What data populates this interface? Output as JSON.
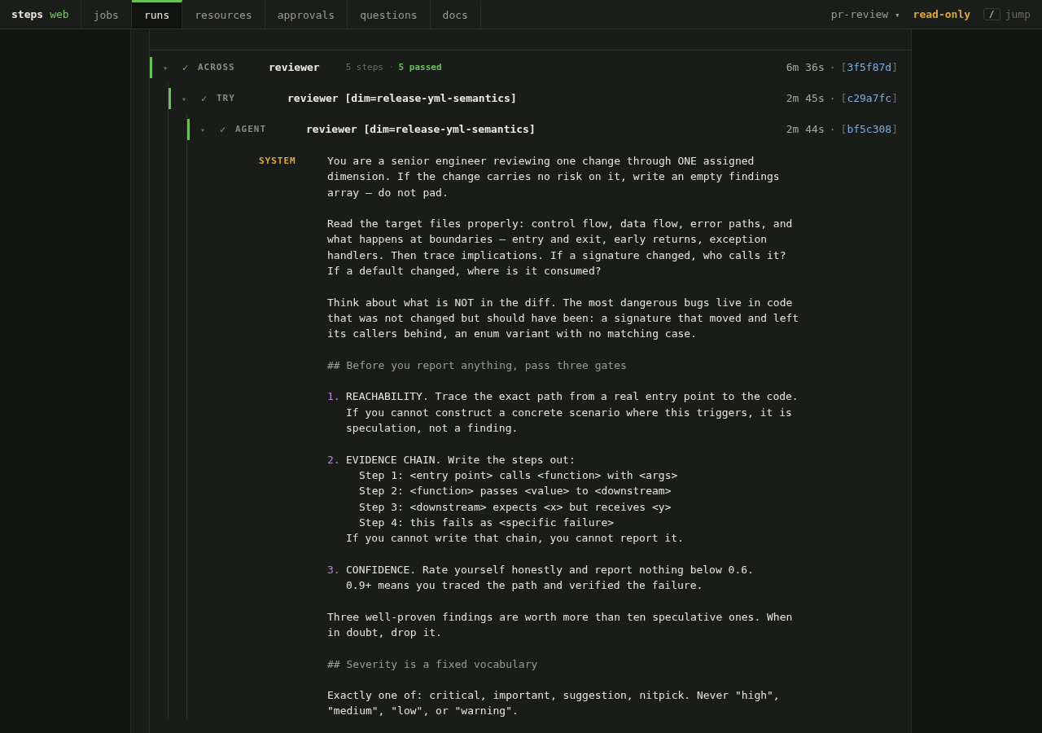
{
  "nav": {
    "brand": {
      "name": "steps",
      "suffix": "web"
    },
    "tabs": [
      {
        "label": "jobs",
        "selected": false
      },
      {
        "label": "runs",
        "selected": true
      },
      {
        "label": "resources",
        "selected": false
      },
      {
        "label": "approvals",
        "selected": false
      },
      {
        "label": "questions",
        "selected": false
      },
      {
        "label": "docs",
        "selected": false
      }
    ],
    "pipeline": {
      "label": "pr-review",
      "caret": "▾"
    },
    "mode": "read-only",
    "shortcut": {
      "key": "/",
      "label": "jump"
    }
  },
  "rows": [
    {
      "kind": "ACROSS",
      "expanded": true,
      "caret": "▾",
      "check": "✓",
      "title": "reviewer",
      "steps": "5 steps",
      "dot": "·",
      "passed": "5 passed",
      "duration": "6m 36s",
      "sep": "·",
      "ref": {
        "open": "[",
        "id": "3f5f87d",
        "close": "]"
      }
    },
    {
      "kind": "TRY",
      "expanded": true,
      "caret": "▾",
      "check": "✓",
      "title": "reviewer [dim=release-yml-semantics]",
      "duration": "2m 45s",
      "sep": "·",
      "ref": {
        "open": "[",
        "id": "c29a7fc",
        "close": "]"
      }
    },
    {
      "kind": "AGENT",
      "expanded": true,
      "caret": "▾",
      "check": "✓",
      "title": "reviewer [dim=release-yml-semantics]",
      "duration": "2m 44s",
      "sep": "·",
      "ref": {
        "open": "[",
        "id": "bf5c308",
        "close": "]"
      }
    }
  ],
  "message": {
    "role": "SYSTEM",
    "blocks": [
      {
        "kind": "paragraph",
        "lines": [
          "You are a senior engineer reviewing one change through ONE assigned",
          "dimension. If the change carries no risk on it, write an empty findings",
          "array — do not pad."
        ]
      },
      {
        "kind": "paragraph",
        "lines": [
          "Read the target files properly: control flow, data flow, error paths, and",
          "what happens at boundaries — entry and exit, early returns, exception",
          "handlers. Then trace implications. If a signature changed, who calls it?",
          "If a default changed, where is it consumed?"
        ]
      },
      {
        "kind": "paragraph",
        "lines": [
          "Think about what is NOT in the diff. The most dangerous bugs live in code",
          "that was not changed but should have been: a signature that moved and left",
          "its callers behind, an enum variant with no matching case."
        ]
      },
      {
        "kind": "heading",
        "text": "## Before you report anything, pass three gates"
      },
      {
        "kind": "numbered",
        "number": "1.",
        "lines": [
          "REACHABILITY. Trace the exact path from a real entry point to the code.",
          "If you cannot construct a concrete scenario where this triggers, it is",
          "speculation, not a finding."
        ]
      },
      {
        "kind": "numbered",
        "number": "2.",
        "lines": [
          "EVIDENCE CHAIN. Write the steps out:"
        ],
        "steps": [
          "Step 1: <entry point> calls <function> with <args>",
          "Step 2: <function> passes <value> to <downstream>",
          "Step 3: <downstream> expects <x> but receives <y>",
          "Step 4: this fails as <specific failure>"
        ],
        "after": [
          "If you cannot write that chain, you cannot report it."
        ]
      },
      {
        "kind": "numbered",
        "number": "3.",
        "lines": [
          "CONFIDENCE. Rate yourself honestly and report nothing below 0.6.",
          "0.9+ means you traced the path and verified the failure."
        ]
      },
      {
        "kind": "paragraph",
        "lines": [
          "Three well-proven findings are worth more than ten speculative ones. When",
          "in doubt, drop it."
        ]
      },
      {
        "kind": "heading",
        "text": "## Severity is a fixed vocabulary"
      },
      {
        "kind": "paragraph",
        "lines": [
          "Exactly one of: critical, important, suggestion, nitpick. Never \"high\",",
          "\"medium\", \"low\", or \"warning\"."
        ]
      }
    ]
  }
}
